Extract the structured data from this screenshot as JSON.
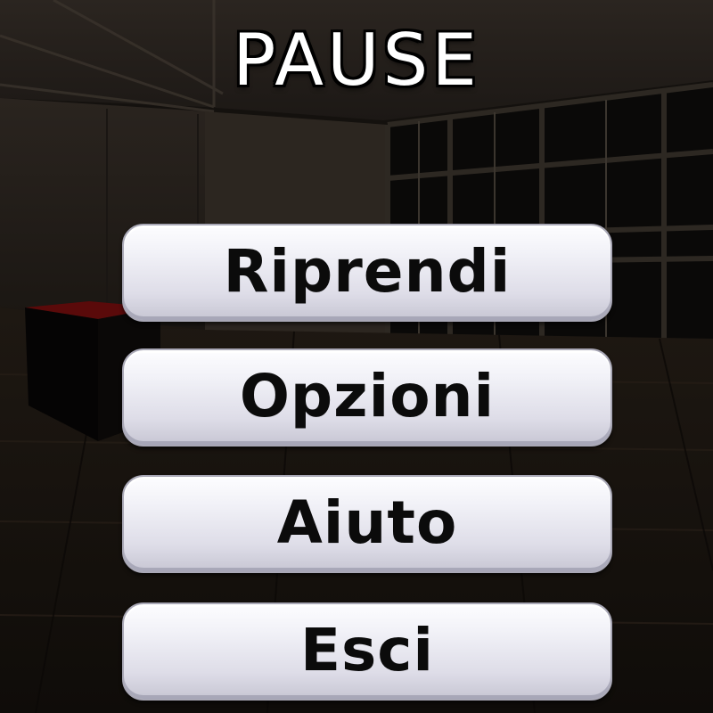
{
  "pause_menu": {
    "title": "PAUSE",
    "buttons": {
      "resume": "Riprendi",
      "options": "Opzioni",
      "help": "Aiuto",
      "quit": "Esci"
    }
  },
  "colors": {
    "title_text": "#ffffff",
    "button_text": "#0b0b0b",
    "button_face": "#e4e3ec"
  }
}
